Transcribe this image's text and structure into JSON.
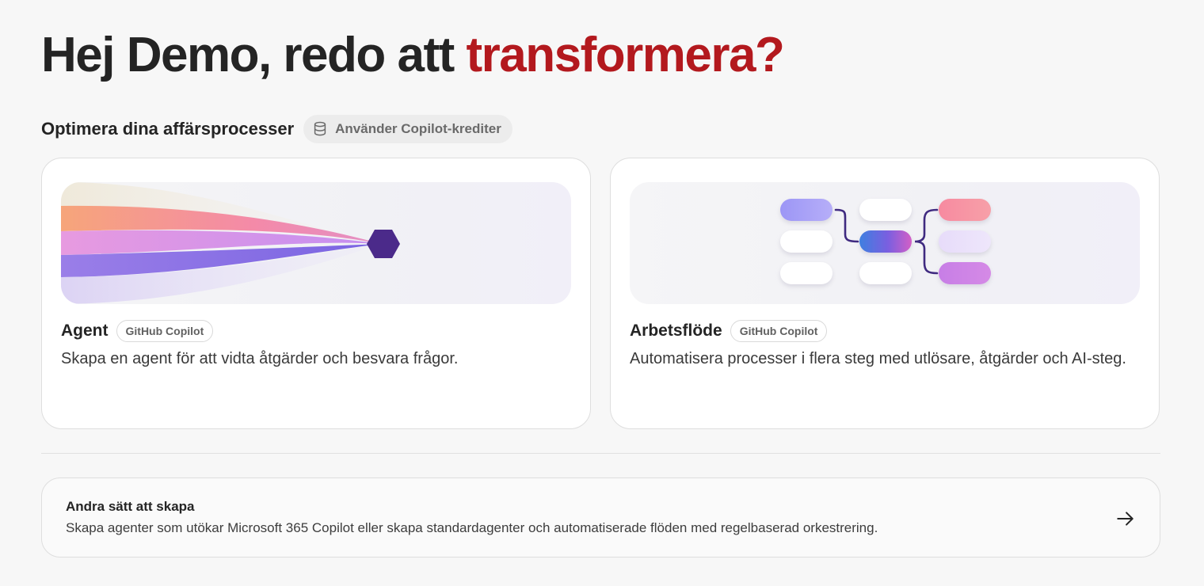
{
  "hero": {
    "greeting": "Hej Demo, redo att ",
    "accent": "transformera?"
  },
  "section": {
    "title": "Optimera dina affärsprocesser",
    "credit_badge": "Använder Copilot-krediter",
    "credit_icon": "database-icon"
  },
  "cards": [
    {
      "title": "Agent",
      "chip": "GitHub Copilot",
      "description": "Skapa en agent för att vidta åtgärder och besvara frågor."
    },
    {
      "title": "Arbetsflöde",
      "chip": "GitHub Copilot",
      "description": "Automatisera processer i flera steg med utlösare, åtgärder och AI-steg."
    }
  ],
  "other": {
    "title": "Andra sätt att skapa",
    "description": "Skapa agenter som utökar Microsoft 365 Copilot eller skapa standardagenter och automatiserade flöden med regelbaserad orkestrering.",
    "icon": "arrow-right-icon"
  },
  "colors": {
    "accent": "#b3191e",
    "hexagon": "#4b2a8a"
  }
}
